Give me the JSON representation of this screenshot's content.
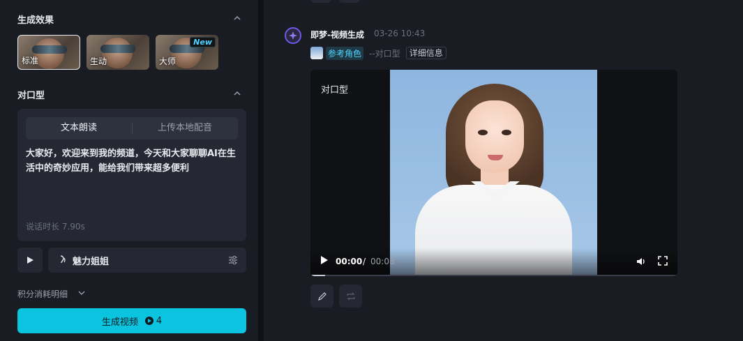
{
  "left": {
    "effects_title": "生成效果",
    "effects": [
      {
        "label": "标准",
        "selected": true
      },
      {
        "label": "生动",
        "selected": false
      },
      {
        "label": "大师",
        "selected": false,
        "badge": "New"
      }
    ],
    "lipsync_title": "对口型",
    "tabs": [
      {
        "label": "文本朗读",
        "active": true
      },
      {
        "label": "上传本地配音",
        "active": false
      }
    ],
    "script_text": "大家好，欢迎来到我的频道，今天和大家聊聊AI在生活中的奇妙应用，能给我们带来超多便利",
    "duration": "说话时长 7.90s",
    "voice_name": "魅力姐姐",
    "cost_label": "积分消耗明细",
    "generate_label": "生成视频",
    "generate_cost": "4"
  },
  "right": {
    "author": "即梦-视频生成",
    "date": "03-26  10:43",
    "ref_label": "参考角色",
    "mode_label": "--对口型",
    "detail_label": "详细信息",
    "video_title": "对口型",
    "time_current": "00:00",
    "time_sep": "/",
    "time_total": "00:08",
    "progress": 0.04
  },
  "colors": {
    "accent": "#0bc4e0",
    "cyan_text": "#4fd2ff",
    "avatar_ring": "#6f5ae6"
  }
}
